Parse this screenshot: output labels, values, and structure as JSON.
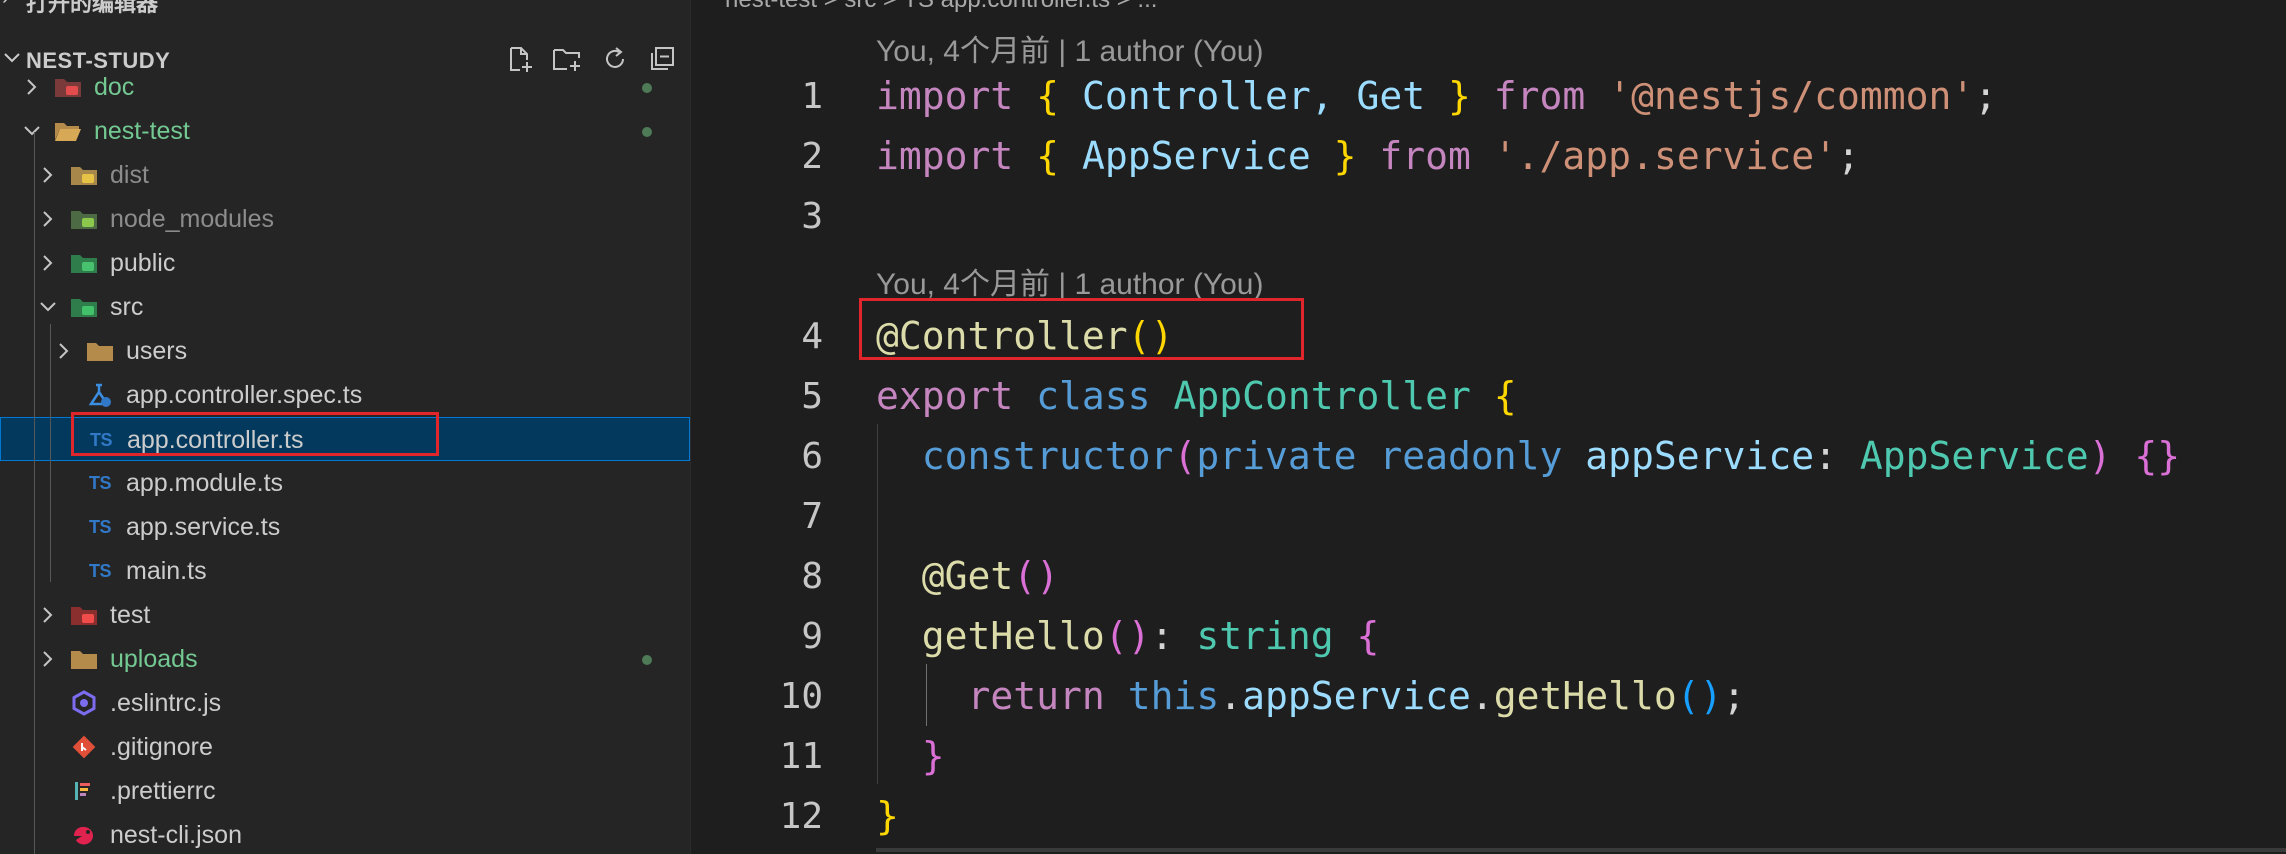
{
  "top_strip": {
    "label": "打开的编辑器"
  },
  "explorer": {
    "title": "NEST-STUDY",
    "actions": [
      "new-file",
      "new-folder",
      "refresh",
      "collapse-all"
    ],
    "items": [
      {
        "label": "doc",
        "depth": 0,
        "kind": "folder",
        "icon": "doc-folder-icon",
        "expanded": false,
        "modified_dot": true,
        "color": "green"
      },
      {
        "label": "nest-test",
        "depth": 0,
        "kind": "folder",
        "icon": "open-folder-icon",
        "expanded": true,
        "modified_dot": true,
        "color": "green"
      },
      {
        "label": "dist",
        "depth": 1,
        "kind": "folder",
        "icon": "dist-folder-icon",
        "expanded": false,
        "color": "dim"
      },
      {
        "label": "node_modules",
        "depth": 1,
        "kind": "folder",
        "icon": "node-folder-icon",
        "expanded": false,
        "color": "dim"
      },
      {
        "label": "public",
        "depth": 1,
        "kind": "folder",
        "icon": "public-folder-icon",
        "expanded": false
      },
      {
        "label": "src",
        "depth": 1,
        "kind": "folder",
        "icon": "src-folder-icon",
        "expanded": true
      },
      {
        "label": "users",
        "depth": 2,
        "kind": "folder",
        "icon": "folder-icon",
        "expanded": false
      },
      {
        "label": "app.controller.spec.ts",
        "depth": 2,
        "kind": "file",
        "icon": "test-file-icon"
      },
      {
        "label": "app.controller.ts",
        "depth": 2,
        "kind": "file",
        "icon": "typescript-file-icon",
        "selected": true
      },
      {
        "label": "app.module.ts",
        "depth": 2,
        "kind": "file",
        "icon": "typescript-file-icon"
      },
      {
        "label": "app.service.ts",
        "depth": 2,
        "kind": "file",
        "icon": "typescript-file-icon"
      },
      {
        "label": "main.ts",
        "depth": 2,
        "kind": "file",
        "icon": "typescript-file-icon"
      },
      {
        "label": "test",
        "depth": 1,
        "kind": "folder",
        "icon": "test-folder-icon",
        "expanded": false
      },
      {
        "label": "uploads",
        "depth": 1,
        "kind": "folder",
        "icon": "folder-icon",
        "expanded": false,
        "modified_dot": true,
        "color": "green"
      },
      {
        "label": ".eslintrc.js",
        "depth": 1,
        "kind": "file",
        "icon": "eslint-file-icon"
      },
      {
        "label": ".gitignore",
        "depth": 1,
        "kind": "file",
        "icon": "git-file-icon"
      },
      {
        "label": ".prettierrc",
        "depth": 1,
        "kind": "file",
        "icon": "prettier-file-icon"
      },
      {
        "label": "nest-cli.json",
        "depth": 1,
        "kind": "file",
        "icon": "nest-file-icon"
      }
    ],
    "ts_badge": "TS"
  },
  "editor": {
    "breadcrumb": "nest-test > src > TS app.controller.ts > ...",
    "codelens": [
      {
        "text": "You, 4个月前 | 1 author (You)"
      },
      {
        "text": "You, 4个月前 | 1 author (You)"
      }
    ],
    "lines": [
      {
        "n": "1",
        "tokens": [
          [
            "import",
            "k"
          ],
          [
            " ",
            "p"
          ],
          [
            "{",
            "b1"
          ],
          [
            " Controller, Get ",
            "v"
          ],
          [
            "}",
            "b1"
          ],
          [
            " ",
            "p"
          ],
          [
            "from",
            "k"
          ],
          [
            " ",
            "p"
          ],
          [
            "'@nestjs/common'",
            "s"
          ],
          [
            ";",
            "p"
          ]
        ]
      },
      {
        "n": "2",
        "tokens": [
          [
            "import",
            "k"
          ],
          [
            " ",
            "p"
          ],
          [
            "{",
            "b1"
          ],
          [
            " AppService ",
            "v"
          ],
          [
            "}",
            "b1"
          ],
          [
            " ",
            "p"
          ],
          [
            "from",
            "k"
          ],
          [
            " ",
            "p"
          ],
          [
            "'./app.service'",
            "s"
          ],
          [
            ";",
            "p"
          ]
        ]
      },
      {
        "n": "3",
        "tokens": []
      },
      {
        "n": "4",
        "tokens": [
          [
            "@Controller",
            "f"
          ],
          [
            "(",
            "b1"
          ],
          [
            ")",
            "b1"
          ]
        ]
      },
      {
        "n": "5",
        "tokens": [
          [
            "export",
            "k"
          ],
          [
            " ",
            "p"
          ],
          [
            "class",
            "kb"
          ],
          [
            " ",
            "p"
          ],
          [
            "AppController",
            "t"
          ],
          [
            " ",
            "p"
          ],
          [
            "{",
            "b1"
          ]
        ]
      },
      {
        "n": "6",
        "tokens": [
          [
            "  ",
            "p"
          ],
          [
            "constructor",
            "kb"
          ],
          [
            "(",
            "b2"
          ],
          [
            "private",
            "kb"
          ],
          [
            " ",
            "p"
          ],
          [
            "readonly",
            "kb"
          ],
          [
            " ",
            "p"
          ],
          [
            "appService",
            "v"
          ],
          [
            ": ",
            "p"
          ],
          [
            "AppService",
            "t"
          ],
          [
            ") ",
            "b2"
          ],
          [
            "{}",
            "b2"
          ]
        ]
      },
      {
        "n": "7",
        "tokens": []
      },
      {
        "n": "8",
        "tokens": [
          [
            "  ",
            "p"
          ],
          [
            "@Get",
            "f"
          ],
          [
            "()",
            "b2"
          ]
        ]
      },
      {
        "n": "9",
        "tokens": [
          [
            "  ",
            "p"
          ],
          [
            "getHello",
            "f"
          ],
          [
            "()",
            "b2"
          ],
          [
            ": ",
            "p"
          ],
          [
            "string",
            "t"
          ],
          [
            " ",
            "p"
          ],
          [
            "{",
            "b2"
          ]
        ]
      },
      {
        "n": "10",
        "tokens": [
          [
            "    ",
            "p"
          ],
          [
            "return",
            "k"
          ],
          [
            " ",
            "p"
          ],
          [
            "this",
            "kb"
          ],
          [
            ".",
            "p"
          ],
          [
            "appService",
            "v"
          ],
          [
            ".",
            "p"
          ],
          [
            "getHello",
            "f"
          ],
          [
            "()",
            "b3"
          ],
          [
            ";",
            "p"
          ]
        ]
      },
      {
        "n": "11",
        "tokens": [
          [
            "  ",
            "p"
          ],
          [
            "}",
            "b2"
          ]
        ]
      },
      {
        "n": "12",
        "tokens": [
          [
            "}",
            "b1"
          ]
        ]
      }
    ]
  }
}
